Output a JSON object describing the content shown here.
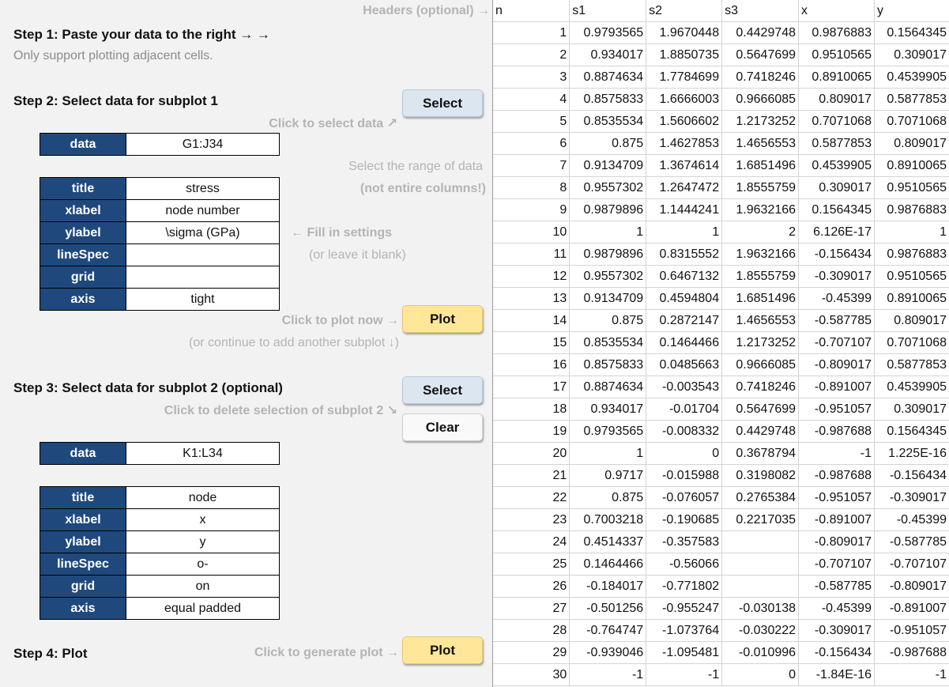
{
  "panel": {
    "headers_hint": "Headers (optional) →",
    "step1_title": "Step 1: Paste your data to the right → →",
    "step1_note": "Only support plotting adjacent cells.",
    "step2_title": "Step 2: Select data for subplot 1",
    "select_label": "Select",
    "click_select_hint": "Click to select data ↗",
    "range_hint1": "Select the range of data",
    "range_hint2": "(not entire columns!)",
    "fill_hint1": "← Fill in settings",
    "fill_hint2": "(or leave it blank)",
    "plot_hint": "Click to plot now →",
    "plot_label": "Plot",
    "continue_hint": "(or continue to add another subplot ↓)",
    "step3_title": "Step 3: Select data for subplot 2 (optional)",
    "delete_hint": "Click to delete selection of subplot 2 ↘",
    "clear_label": "Clear",
    "step4_title": "Step 4: Plot",
    "generate_hint": "Click to generate plot →"
  },
  "subplot1": {
    "data_key": "data",
    "data_value": "G1:J34",
    "settings": [
      {
        "key": "title",
        "value": "stress"
      },
      {
        "key": "xlabel",
        "value": "node number"
      },
      {
        "key": "ylabel",
        "value": "\\sigma (GPa)"
      },
      {
        "key": "lineSpec",
        "value": ""
      },
      {
        "key": "grid",
        "value": ""
      },
      {
        "key": "axis",
        "value": "tight"
      }
    ]
  },
  "subplot2": {
    "data_key": "data",
    "data_value": "K1:L34",
    "settings": [
      {
        "key": "title",
        "value": "node"
      },
      {
        "key": "xlabel",
        "value": "x"
      },
      {
        "key": "ylabel",
        "value": "y"
      },
      {
        "key": "lineSpec",
        "value": "o-"
      },
      {
        "key": "grid",
        "value": "on"
      },
      {
        "key": "axis",
        "value": "equal padded"
      }
    ]
  },
  "sheet": {
    "headers": [
      "n",
      "s1",
      "s2",
      "s3",
      "x",
      "y"
    ],
    "rows": [
      [
        "1",
        "0.9793565",
        "1.9670448",
        "0.4429748",
        "0.9876883",
        "0.1564345"
      ],
      [
        "2",
        "0.934017",
        "1.8850735",
        "0.5647699",
        "0.9510565",
        "0.309017"
      ],
      [
        "3",
        "0.8874634",
        "1.7784699",
        "0.7418246",
        "0.8910065",
        "0.4539905"
      ],
      [
        "4",
        "0.8575833",
        "1.6666003",
        "0.9666085",
        "0.809017",
        "0.5877853"
      ],
      [
        "5",
        "0.8535534",
        "1.5606602",
        "1.2173252",
        "0.7071068",
        "0.7071068"
      ],
      [
        "6",
        "0.875",
        "1.4627853",
        "1.4656553",
        "0.5877853",
        "0.809017"
      ],
      [
        "7",
        "0.9134709",
        "1.3674614",
        "1.6851496",
        "0.4539905",
        "0.8910065"
      ],
      [
        "8",
        "0.9557302",
        "1.2647472",
        "1.8555759",
        "0.309017",
        "0.9510565"
      ],
      [
        "9",
        "0.9879896",
        "1.1444241",
        "1.9632166",
        "0.1564345",
        "0.9876883"
      ],
      [
        "10",
        "1",
        "1",
        "2",
        "6.126E-17",
        "1"
      ],
      [
        "11",
        "0.9879896",
        "0.8315552",
        "1.9632166",
        "-0.156434",
        "0.9876883"
      ],
      [
        "12",
        "0.9557302",
        "0.6467132",
        "1.8555759",
        "-0.309017",
        "0.9510565"
      ],
      [
        "13",
        "0.9134709",
        "0.4594804",
        "1.6851496",
        "-0.45399",
        "0.8910065"
      ],
      [
        "14",
        "0.875",
        "0.2872147",
        "1.4656553",
        "-0.587785",
        "0.809017"
      ],
      [
        "15",
        "0.8535534",
        "0.1464466",
        "1.2173252",
        "-0.707107",
        "0.7071068"
      ],
      [
        "16",
        "0.8575833",
        "0.0485663",
        "0.9666085",
        "-0.809017",
        "0.5877853"
      ],
      [
        "17",
        "0.8874634",
        "-0.003543",
        "0.7418246",
        "-0.891007",
        "0.4539905"
      ],
      [
        "18",
        "0.934017",
        "-0.01704",
        "0.5647699",
        "-0.951057",
        "0.309017"
      ],
      [
        "19",
        "0.9793565",
        "-0.008332",
        "0.4429748",
        "-0.987688",
        "0.1564345"
      ],
      [
        "20",
        "1",
        "0",
        "0.3678794",
        "-1",
        "1.225E-16"
      ],
      [
        "21",
        "0.9717",
        "-0.015988",
        "0.3198082",
        "-0.987688",
        "-0.156434"
      ],
      [
        "22",
        "0.875",
        "-0.076057",
        "0.2765384",
        "-0.951057",
        "-0.309017"
      ],
      [
        "23",
        "0.7003218",
        "-0.190685",
        "0.2217035",
        "-0.891007",
        "-0.45399"
      ],
      [
        "24",
        "0.4514337",
        "-0.357583",
        "",
        "-0.809017",
        "-0.587785"
      ],
      [
        "25",
        "0.1464466",
        "-0.56066",
        "",
        "-0.707107",
        "-0.707107"
      ],
      [
        "26",
        "-0.184017",
        "-0.771802",
        "",
        "-0.587785",
        "-0.809017"
      ],
      [
        "27",
        "-0.501256",
        "-0.955247",
        "-0.030138",
        "-0.45399",
        "-0.891007"
      ],
      [
        "28",
        "-0.764747",
        "-1.073764",
        "-0.030222",
        "-0.309017",
        "-0.951057"
      ],
      [
        "29",
        "-0.939046",
        "-1.095481",
        "-0.010996",
        "-0.156434",
        "-0.987688"
      ],
      [
        "30",
        "-1",
        "-1",
        "0",
        "-1.84E-16",
        "-1"
      ]
    ]
  },
  "colors": {
    "header_cell": "#1f497d",
    "button_blue": "#dce6f1",
    "button_yellow": "#ffe699",
    "hint_gray": "#b4b4b4"
  }
}
